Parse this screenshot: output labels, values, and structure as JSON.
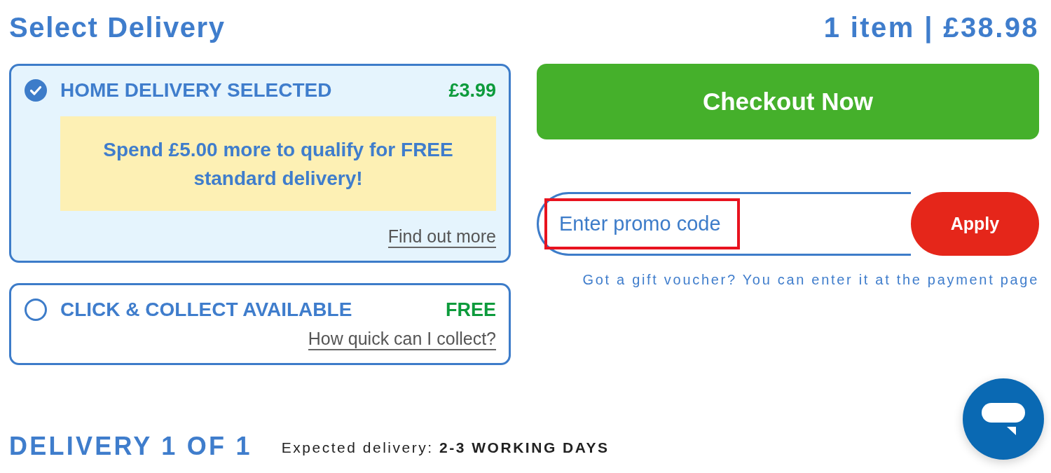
{
  "header": {
    "title": "Select Delivery",
    "summary": "1 item | £38.98"
  },
  "delivery_options": [
    {
      "selected": true,
      "title": "HOME DELIVERY SELECTED",
      "price": "£3.99",
      "notice": "Spend £5.00 more to qualify for FREE standard delivery!",
      "link": "Find out more"
    },
    {
      "selected": false,
      "title": "CLICK & COLLECT AVAILABLE",
      "price": "FREE",
      "link": "How quick can I collect?"
    }
  ],
  "checkout_button": {
    "label": "Checkout Now"
  },
  "promo": {
    "placeholder": "Enter promo code",
    "highlighted": true,
    "button": "Apply",
    "note": "Got a gift voucher? You can enter it at the payment page"
  },
  "delivery_section": {
    "title": "DELIVERY 1 OF 1",
    "expected": "Expected delivery: **2-3 WORKING DAYS**"
  }
}
